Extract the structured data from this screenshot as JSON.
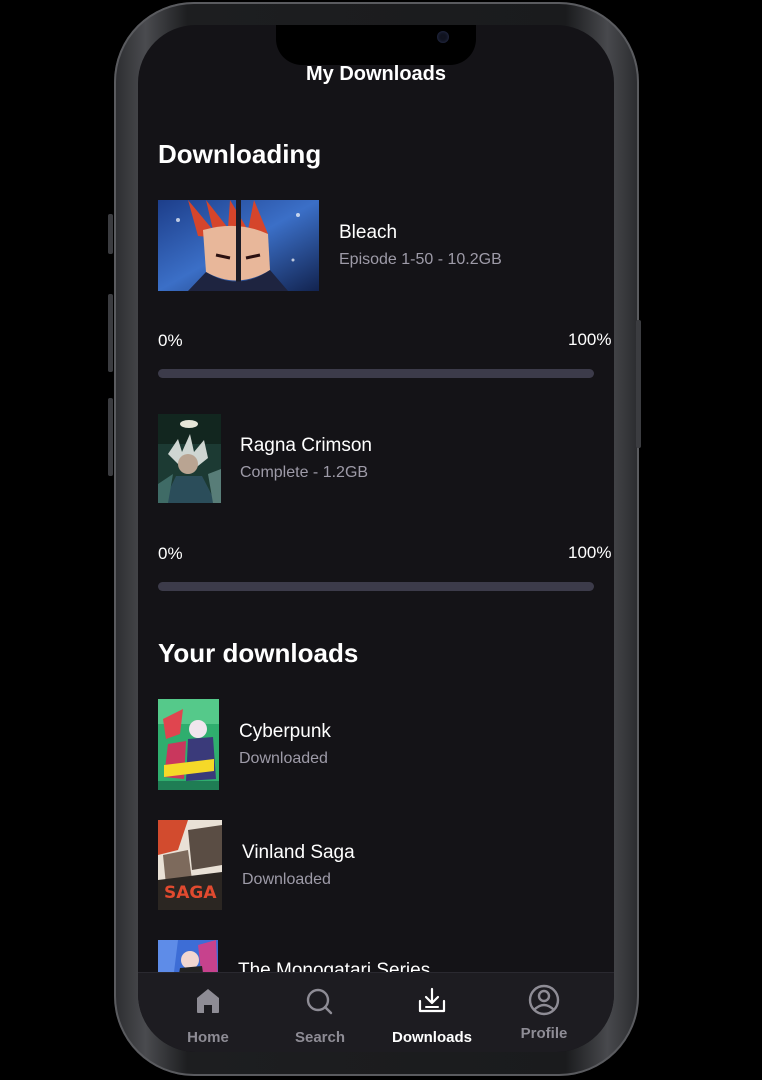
{
  "header": {
    "title": "My Downloads"
  },
  "downloading": {
    "section_title": "Downloading",
    "items": [
      {
        "title": "Bleach",
        "subtitle": "Episode 1-50 - 10.2GB",
        "progress_start_label": "0%",
        "progress_end_label": "100%",
        "progress": 0
      },
      {
        "title": "Ragna Crimson",
        "subtitle": "Complete - 1.2GB",
        "progress_start_label": "0%",
        "progress_end_label": "100%",
        "progress": 0
      }
    ]
  },
  "your_downloads": {
    "section_title": "Your downloads",
    "items": [
      {
        "title": "Cyberpunk",
        "status": "Downloaded"
      },
      {
        "title": "Vinland Saga",
        "status": "Downloaded"
      },
      {
        "title": "The Monogatari Series",
        "status": ""
      }
    ]
  },
  "tabbar": {
    "tabs": [
      {
        "label": "Home",
        "icon": "home-icon"
      },
      {
        "label": "Search",
        "icon": "search-icon"
      },
      {
        "label": "Downloads",
        "icon": "download-icon",
        "active": true
      },
      {
        "label": "Profile",
        "icon": "profile-icon"
      }
    ]
  },
  "colors": {
    "background": "#141317",
    "tabbar": "#1d1c21",
    "progress_track": "#3c3b4a",
    "subtitle": "#9e9ba8",
    "inactive_tab": "#8e8c95"
  }
}
